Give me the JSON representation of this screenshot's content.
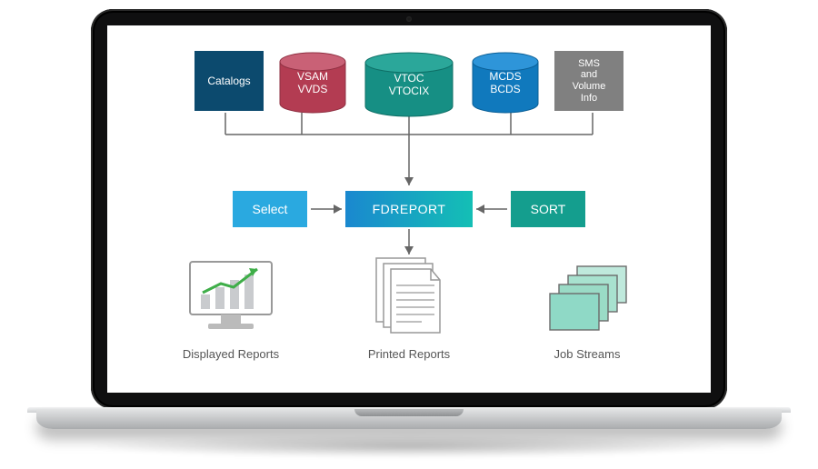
{
  "diagram": {
    "top": {
      "catalogs": "Catalogs",
      "vsam_line1": "VSAM",
      "vsam_line2": "VVDS",
      "vtoc_line1": "VTOC",
      "vtoc_line2": "VTOCIX",
      "mcds_line1": "MCDS",
      "mcds_line2": "BCDS",
      "sms_line1": "SMS",
      "sms_line2": "and",
      "sms_line3": "Volume",
      "sms_line4": "Info"
    },
    "mid": {
      "select": "Select",
      "fdreport": "FDREPORT",
      "sort": "SORT"
    },
    "bottom": {
      "displayed": "Displayed Reports",
      "printed": "Printed Reports",
      "jobstreams": "Job Streams"
    },
    "colors": {
      "catalogs_bg": "#0c4a6e",
      "vsam_fill": "#c0475e",
      "vtoc_fill": "#168f84",
      "mcds_fill": "#1f8fd6",
      "sms_bg": "#808080",
      "select_bg": "#2aa9e0",
      "sort_bg": "#149e8e",
      "line": "#666666",
      "jobcard": "#8fd9c6"
    }
  }
}
